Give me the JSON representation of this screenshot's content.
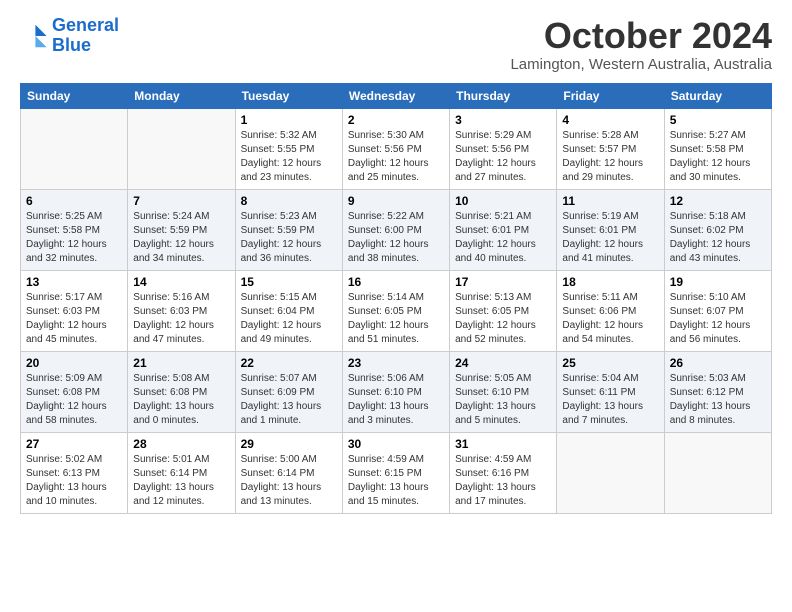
{
  "logo": {
    "line1": "General",
    "line2": "Blue"
  },
  "title": "October 2024",
  "subtitle": "Lamington, Western Australia, Australia",
  "weekdays": [
    "Sunday",
    "Monday",
    "Tuesday",
    "Wednesday",
    "Thursday",
    "Friday",
    "Saturday"
  ],
  "weeks": [
    [
      {
        "day": "",
        "sunrise": "",
        "sunset": "",
        "daylight": ""
      },
      {
        "day": "",
        "sunrise": "",
        "sunset": "",
        "daylight": ""
      },
      {
        "day": "1",
        "sunrise": "Sunrise: 5:32 AM",
        "sunset": "Sunset: 5:55 PM",
        "daylight": "Daylight: 12 hours and 23 minutes."
      },
      {
        "day": "2",
        "sunrise": "Sunrise: 5:30 AM",
        "sunset": "Sunset: 5:56 PM",
        "daylight": "Daylight: 12 hours and 25 minutes."
      },
      {
        "day": "3",
        "sunrise": "Sunrise: 5:29 AM",
        "sunset": "Sunset: 5:56 PM",
        "daylight": "Daylight: 12 hours and 27 minutes."
      },
      {
        "day": "4",
        "sunrise": "Sunrise: 5:28 AM",
        "sunset": "Sunset: 5:57 PM",
        "daylight": "Daylight: 12 hours and 29 minutes."
      },
      {
        "day": "5",
        "sunrise": "Sunrise: 5:27 AM",
        "sunset": "Sunset: 5:58 PM",
        "daylight": "Daylight: 12 hours and 30 minutes."
      }
    ],
    [
      {
        "day": "6",
        "sunrise": "Sunrise: 5:25 AM",
        "sunset": "Sunset: 5:58 PM",
        "daylight": "Daylight: 12 hours and 32 minutes."
      },
      {
        "day": "7",
        "sunrise": "Sunrise: 5:24 AM",
        "sunset": "Sunset: 5:59 PM",
        "daylight": "Daylight: 12 hours and 34 minutes."
      },
      {
        "day": "8",
        "sunrise": "Sunrise: 5:23 AM",
        "sunset": "Sunset: 5:59 PM",
        "daylight": "Daylight: 12 hours and 36 minutes."
      },
      {
        "day": "9",
        "sunrise": "Sunrise: 5:22 AM",
        "sunset": "Sunset: 6:00 PM",
        "daylight": "Daylight: 12 hours and 38 minutes."
      },
      {
        "day": "10",
        "sunrise": "Sunrise: 5:21 AM",
        "sunset": "Sunset: 6:01 PM",
        "daylight": "Daylight: 12 hours and 40 minutes."
      },
      {
        "day": "11",
        "sunrise": "Sunrise: 5:19 AM",
        "sunset": "Sunset: 6:01 PM",
        "daylight": "Daylight: 12 hours and 41 minutes."
      },
      {
        "day": "12",
        "sunrise": "Sunrise: 5:18 AM",
        "sunset": "Sunset: 6:02 PM",
        "daylight": "Daylight: 12 hours and 43 minutes."
      }
    ],
    [
      {
        "day": "13",
        "sunrise": "Sunrise: 5:17 AM",
        "sunset": "Sunset: 6:03 PM",
        "daylight": "Daylight: 12 hours and 45 minutes."
      },
      {
        "day": "14",
        "sunrise": "Sunrise: 5:16 AM",
        "sunset": "Sunset: 6:03 PM",
        "daylight": "Daylight: 12 hours and 47 minutes."
      },
      {
        "day": "15",
        "sunrise": "Sunrise: 5:15 AM",
        "sunset": "Sunset: 6:04 PM",
        "daylight": "Daylight: 12 hours and 49 minutes."
      },
      {
        "day": "16",
        "sunrise": "Sunrise: 5:14 AM",
        "sunset": "Sunset: 6:05 PM",
        "daylight": "Daylight: 12 hours and 51 minutes."
      },
      {
        "day": "17",
        "sunrise": "Sunrise: 5:13 AM",
        "sunset": "Sunset: 6:05 PM",
        "daylight": "Daylight: 12 hours and 52 minutes."
      },
      {
        "day": "18",
        "sunrise": "Sunrise: 5:11 AM",
        "sunset": "Sunset: 6:06 PM",
        "daylight": "Daylight: 12 hours and 54 minutes."
      },
      {
        "day": "19",
        "sunrise": "Sunrise: 5:10 AM",
        "sunset": "Sunset: 6:07 PM",
        "daylight": "Daylight: 12 hours and 56 minutes."
      }
    ],
    [
      {
        "day": "20",
        "sunrise": "Sunrise: 5:09 AM",
        "sunset": "Sunset: 6:08 PM",
        "daylight": "Daylight: 12 hours and 58 minutes."
      },
      {
        "day": "21",
        "sunrise": "Sunrise: 5:08 AM",
        "sunset": "Sunset: 6:08 PM",
        "daylight": "Daylight: 13 hours and 0 minutes."
      },
      {
        "day": "22",
        "sunrise": "Sunrise: 5:07 AM",
        "sunset": "Sunset: 6:09 PM",
        "daylight": "Daylight: 13 hours and 1 minute."
      },
      {
        "day": "23",
        "sunrise": "Sunrise: 5:06 AM",
        "sunset": "Sunset: 6:10 PM",
        "daylight": "Daylight: 13 hours and 3 minutes."
      },
      {
        "day": "24",
        "sunrise": "Sunrise: 5:05 AM",
        "sunset": "Sunset: 6:10 PM",
        "daylight": "Daylight: 13 hours and 5 minutes."
      },
      {
        "day": "25",
        "sunrise": "Sunrise: 5:04 AM",
        "sunset": "Sunset: 6:11 PM",
        "daylight": "Daylight: 13 hours and 7 minutes."
      },
      {
        "day": "26",
        "sunrise": "Sunrise: 5:03 AM",
        "sunset": "Sunset: 6:12 PM",
        "daylight": "Daylight: 13 hours and 8 minutes."
      }
    ],
    [
      {
        "day": "27",
        "sunrise": "Sunrise: 5:02 AM",
        "sunset": "Sunset: 6:13 PM",
        "daylight": "Daylight: 13 hours and 10 minutes."
      },
      {
        "day": "28",
        "sunrise": "Sunrise: 5:01 AM",
        "sunset": "Sunset: 6:14 PM",
        "daylight": "Daylight: 13 hours and 12 minutes."
      },
      {
        "day": "29",
        "sunrise": "Sunrise: 5:00 AM",
        "sunset": "Sunset: 6:14 PM",
        "daylight": "Daylight: 13 hours and 13 minutes."
      },
      {
        "day": "30",
        "sunrise": "Sunrise: 4:59 AM",
        "sunset": "Sunset: 6:15 PM",
        "daylight": "Daylight: 13 hours and 15 minutes."
      },
      {
        "day": "31",
        "sunrise": "Sunrise: 4:59 AM",
        "sunset": "Sunset: 6:16 PM",
        "daylight": "Daylight: 13 hours and 17 minutes."
      },
      {
        "day": "",
        "sunrise": "",
        "sunset": "",
        "daylight": ""
      },
      {
        "day": "",
        "sunrise": "",
        "sunset": "",
        "daylight": ""
      }
    ]
  ]
}
